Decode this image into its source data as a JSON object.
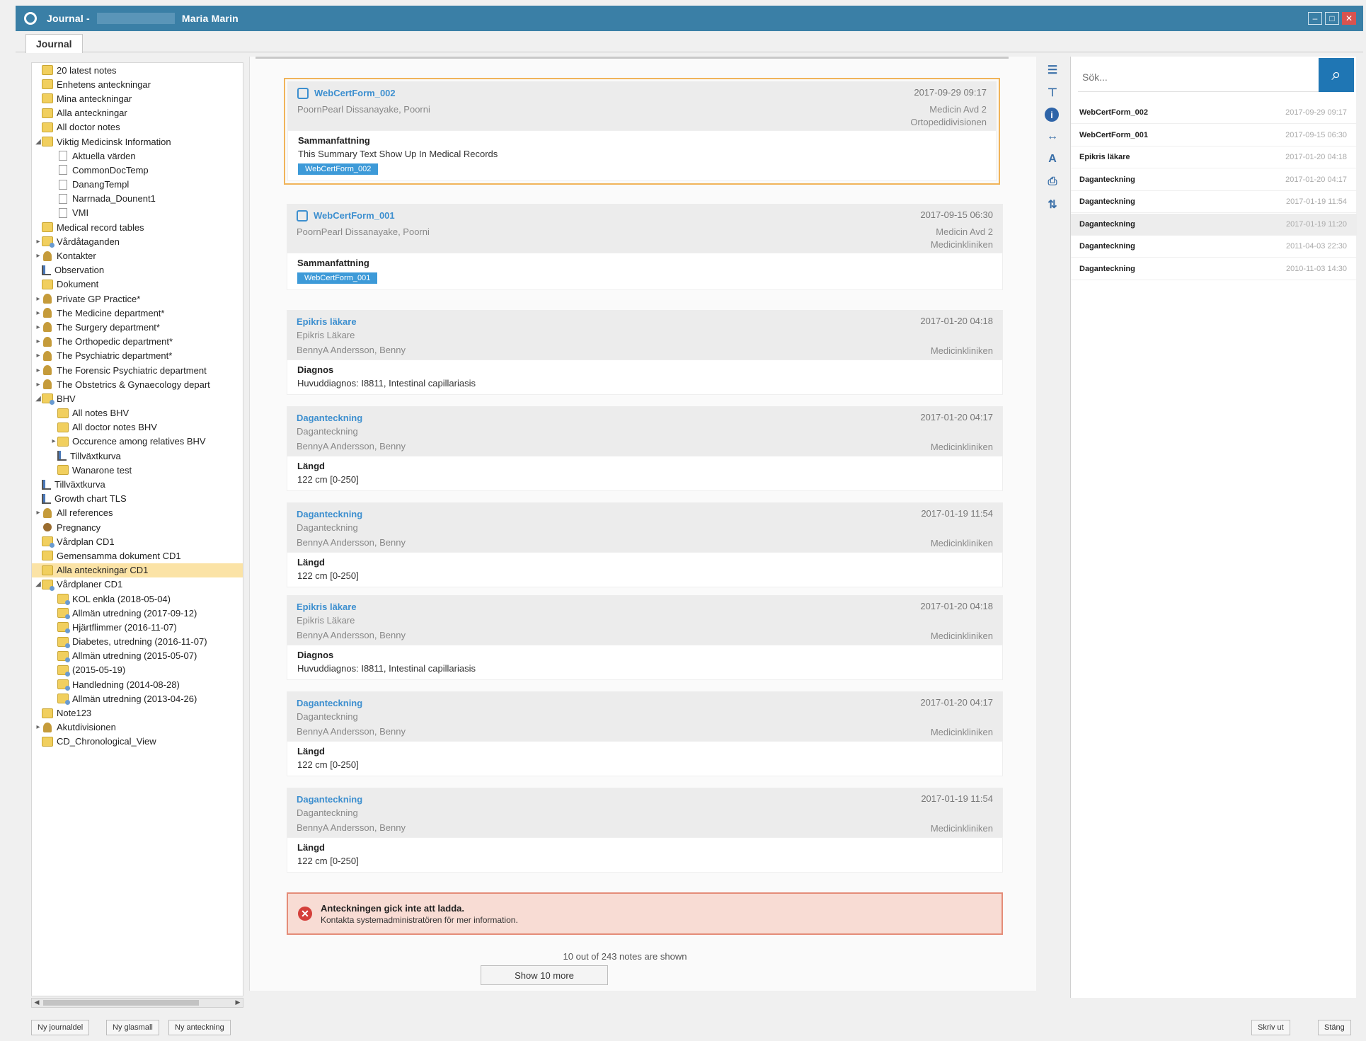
{
  "window": {
    "title": "Journal -",
    "patient_name": "Maria Marin",
    "tab_label": "Journal"
  },
  "tree": {
    "items": [
      {
        "label": "20 latest notes",
        "icon": "folder-icon",
        "toggle": "",
        "indent": 0
      },
      {
        "label": "Enhetens anteckningar",
        "icon": "folder-icon",
        "toggle": "",
        "indent": 0
      },
      {
        "label": "Mina anteckningar",
        "icon": "folder-icon",
        "toggle": "",
        "indent": 0
      },
      {
        "label": "Alla anteckningar",
        "icon": "folder-icon",
        "toggle": "",
        "indent": 0
      },
      {
        "label": "All doctor notes",
        "icon": "folder-icon",
        "toggle": "",
        "indent": 0
      },
      {
        "label": "Viktig Medicinsk Information",
        "icon": "folder-icon",
        "toggle": "◢",
        "indent": 0
      },
      {
        "label": "Aktuella värden",
        "icon": "document-icon",
        "toggle": "",
        "indent": 1
      },
      {
        "label": "CommonDocTemp",
        "icon": "document-icon",
        "toggle": "",
        "indent": 1
      },
      {
        "label": "DanangTempl",
        "icon": "document-icon",
        "toggle": "",
        "indent": 1
      },
      {
        "label": "Narrnada_Dounent1",
        "icon": "document-icon",
        "toggle": "",
        "indent": 1
      },
      {
        "label": "VMI",
        "icon": "document-icon",
        "toggle": "",
        "indent": 1
      },
      {
        "label": "Medical record tables",
        "icon": "folder-icon",
        "toggle": "",
        "indent": 0
      },
      {
        "label": "Vårdåtaganden",
        "icon": "personal-folder-icon",
        "toggle": "▸",
        "indent": 0
      },
      {
        "label": "Kontakter",
        "icon": "group-icon",
        "toggle": "▸",
        "indent": 0
      },
      {
        "label": "Observation",
        "icon": "chart-icon",
        "toggle": "",
        "indent": 0
      },
      {
        "label": "Dokument",
        "icon": "folder-icon",
        "toggle": "",
        "indent": 0
      },
      {
        "label": "Private GP Practice*",
        "icon": "group-icon",
        "toggle": "▸",
        "indent": 0
      },
      {
        "label": "The Medicine department*",
        "icon": "group-icon",
        "toggle": "▸",
        "indent": 0
      },
      {
        "label": "The Surgery department*",
        "icon": "group-icon",
        "toggle": "▸",
        "indent": 0
      },
      {
        "label": "The Orthopedic department*",
        "icon": "group-icon",
        "toggle": "▸",
        "indent": 0
      },
      {
        "label": "The Psychiatric department*",
        "icon": "group-icon",
        "toggle": "▸",
        "indent": 0
      },
      {
        "label": "The Forensic Psychiatric department",
        "icon": "group-icon",
        "toggle": "▸",
        "indent": 0
      },
      {
        "label": "The Obstetrics & Gynaecology depart",
        "icon": "group-icon",
        "toggle": "▸",
        "indent": 0
      },
      {
        "label": "BHV",
        "icon": "personal-folder-icon",
        "toggle": "◢",
        "indent": 0
      },
      {
        "label": "All notes BHV",
        "icon": "folder-icon",
        "toggle": "",
        "indent": 1
      },
      {
        "label": "All doctor notes BHV",
        "icon": "folder-icon",
        "toggle": "",
        "indent": 1
      },
      {
        "label": "Occurence among relatives BHV",
        "icon": "folder-icon",
        "toggle": "▸",
        "indent": 1
      },
      {
        "label": "Tillväxtkurva",
        "icon": "chart-icon",
        "toggle": "",
        "indent": 1
      },
      {
        "label": "Wanarone test",
        "icon": "folder-icon",
        "toggle": "",
        "indent": 1
      },
      {
        "label": "Tillväxtkurva",
        "icon": "chart-icon",
        "toggle": "",
        "indent": 0
      },
      {
        "label": "Growth chart TLS",
        "icon": "chart-icon",
        "toggle": "",
        "indent": 0
      },
      {
        "label": "All references",
        "icon": "group-icon",
        "toggle": "▸",
        "indent": 0
      },
      {
        "label": "Pregnancy",
        "icon": "person-icon",
        "toggle": "",
        "indent": 0
      },
      {
        "label": "Vårdplan CD1",
        "icon": "personal-folder-icon",
        "toggle": "",
        "indent": 0
      },
      {
        "label": "Gemensamma dokument CD1",
        "icon": "folder-icon",
        "toggle": "",
        "indent": 0
      },
      {
        "label": "Alla anteckningar CD1",
        "icon": "folder-icon",
        "toggle": "",
        "indent": 0,
        "selected": true
      },
      {
        "label": "Vårdplaner CD1",
        "icon": "personal-folder-icon",
        "toggle": "◢",
        "indent": 0
      },
      {
        "label": "KOL enkla (2018-05-04)",
        "icon": "personal-folder-icon",
        "toggle": "",
        "indent": 1
      },
      {
        "label": "Allmän utredning (2017-09-12)",
        "icon": "personal-folder-icon",
        "toggle": "",
        "indent": 1
      },
      {
        "label": "Hjärtflimmer (2016-11-07)",
        "icon": "personal-folder-icon",
        "toggle": "",
        "indent": 1
      },
      {
        "label": "Diabetes, utredning (2016-11-07)",
        "icon": "personal-folder-icon",
        "toggle": "",
        "indent": 1
      },
      {
        "label": "Allmän utredning (2015-05-07)",
        "icon": "personal-folder-icon",
        "toggle": "",
        "indent": 1
      },
      {
        "label": "(2015-05-19)",
        "icon": "personal-folder-icon",
        "toggle": "",
        "indent": 1
      },
      {
        "label": "Handledning (2014-08-28)",
        "icon": "personal-folder-icon",
        "toggle": "",
        "indent": 1
      },
      {
        "label": "Allmän utredning (2013-04-26)",
        "icon": "personal-folder-icon",
        "toggle": "",
        "indent": 1
      },
      {
        "label": "Note123",
        "icon": "folder-icon",
        "toggle": "",
        "indent": 0
      },
      {
        "label": "Akutdivisionen",
        "icon": "group-icon",
        "toggle": "▸",
        "indent": 0
      },
      {
        "label": "CD_Chronological_View",
        "icon": "folder-icon",
        "toggle": "",
        "indent": 0
      }
    ]
  },
  "notes": [
    {
      "title": "WebCertForm_002",
      "date": "2017-09-29 09:17",
      "subtitle": "",
      "author": "PoornPearl Dissanayake, Poorni",
      "dept": "Medicin Avd 2",
      "dept2": "Ortopedidivisionen",
      "label": "Sammanfattning",
      "value": "This Summary Text Show Up In Medical Records",
      "tag": "WebCertForm_002",
      "highlight": true
    },
    {
      "title": "WebCertForm_001",
      "date": "2017-09-15 06:30",
      "subtitle": "",
      "author": "PoornPearl Dissanayake, Poorni",
      "dept": "Medicin Avd 2",
      "dept2": "Medicinkliniken",
      "label": "Sammanfattning",
      "value": "",
      "tag": "WebCertForm_001",
      "highlight": false
    },
    {
      "title": "Epikris läkare",
      "date": "2017-01-20 04:18",
      "subtitle": "Epikris Läkare",
      "author": "BennyA Andersson, Benny",
      "dept": "Medicinkliniken",
      "dept2": "",
      "label": "Diagnos",
      "value": "Huvuddiagnos: I8811, Intestinal capillariasis",
      "tag": "",
      "highlight": false
    },
    {
      "title": "Daganteckning",
      "date": "2017-01-20 04:17",
      "subtitle": "Daganteckning",
      "author": "BennyA Andersson, Benny",
      "dept": "Medicinkliniken",
      "dept2": "",
      "label": "Längd",
      "value": "122 cm [0-250]",
      "tag": "",
      "highlight": false
    },
    {
      "title": "Daganteckning",
      "date": "2017-01-19 11:54",
      "subtitle": "Daganteckning",
      "author": "BennyA Andersson, Benny",
      "dept": "Medicinkliniken",
      "dept2": "",
      "label": "Längd",
      "value": "122 cm [0-250]",
      "tag": "",
      "highlight": false
    },
    {
      "title": "Epikris läkare",
      "date": "2017-01-20 04:18",
      "subtitle": "Epikris Läkare",
      "author": "BennyA Andersson, Benny",
      "dept": "Medicinkliniken",
      "dept2": "",
      "label": "Diagnos",
      "value": "Huvuddiagnos: I8811, Intestinal capillariasis",
      "tag": "",
      "highlight": false
    },
    {
      "title": "Daganteckning",
      "date": "2017-01-20 04:17",
      "subtitle": "Daganteckning",
      "author": "BennyA Andersson, Benny",
      "dept": "Medicinkliniken",
      "dept2": "",
      "label": "Längd",
      "value": "122 cm [0-250]",
      "tag": "",
      "highlight": false
    },
    {
      "title": "Daganteckning",
      "date": "2017-01-19 11:54",
      "subtitle": "Daganteckning",
      "author": "BennyA Andersson, Benny",
      "dept": "Medicinkliniken",
      "dept2": "",
      "label": "Längd",
      "value": "122 cm [0-250]",
      "tag": "",
      "highlight": false
    }
  ],
  "error": {
    "title": "Anteckningen gick inte att ladda.",
    "message": "Kontakta systemadministratören för mer information."
  },
  "pager": {
    "shown_text": "10 out of 243 notes are shown",
    "show_more_label": "Show 10 more"
  },
  "toolbar": {
    "icons": [
      "list-icon",
      "filter-icon",
      "info-icon",
      "collapse-icon",
      "font-size-icon",
      "print-icon",
      "sort-icon"
    ]
  },
  "rightpanel": {
    "search_placeholder": "Sök...",
    "items": [
      {
        "name": "WebCertForm_002",
        "date": "2017-09-29 09:17"
      },
      {
        "name": "WebCertForm_001",
        "date": "2017-09-15 06:30"
      },
      {
        "name": "Epikris läkare",
        "date": "2017-01-20 04:18"
      },
      {
        "name": "Daganteckning",
        "date": "2017-01-20 04:17"
      },
      {
        "name": "Daganteckning",
        "date": "2017-01-19 11:54"
      },
      {
        "name": "Daganteckning",
        "date": "2017-01-19 11:20"
      },
      {
        "name": "Daganteckning",
        "date": "2011-04-03 22:30"
      },
      {
        "name": "Daganteckning",
        "date": "2010-11-03 14:30"
      }
    ]
  },
  "bottombar": {
    "new_journal_label": "Ny journaldel",
    "new_template_label": "Ny glasmall",
    "new_note_label": "Ny anteckning",
    "print_label": "Skriv ut",
    "close_label": "Stäng"
  }
}
